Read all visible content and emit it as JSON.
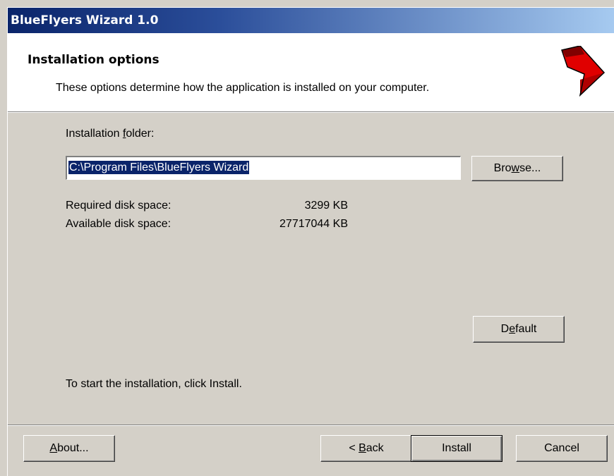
{
  "window": {
    "title": "BlueFlyers Wizard 1.0"
  },
  "header": {
    "title": "Installation options",
    "subtitle": "These options determine how the application is installed on your computer.",
    "logo_icon": "red-arrow-icon"
  },
  "folder": {
    "label_pre": "Installation ",
    "label_mn": "f",
    "label_post": "older:",
    "value": "C:\\Program Files\\BlueFlyers Wizard"
  },
  "browse_button": {
    "pre": "Bro",
    "mn": "w",
    "post": "se..."
  },
  "disk": {
    "required_label": "Required disk space:",
    "required_value": "3299 KB",
    "available_label": "Available disk space:",
    "available_value": "27717044 KB"
  },
  "default_button": {
    "pre": "D",
    "mn": "e",
    "post": "fault"
  },
  "instructions": "To start the installation, click Install.",
  "footer": {
    "about": {
      "mn": "A",
      "post": "bout..."
    },
    "back": {
      "pre": "< ",
      "mn": "B",
      "post": "ack"
    },
    "install": "Install",
    "cancel": "Cancel"
  },
  "colors": {
    "titlebar_start": "#0a246a",
    "titlebar_end": "#a6caf0",
    "face": "#d4d0c8",
    "logo": "#e00000"
  }
}
